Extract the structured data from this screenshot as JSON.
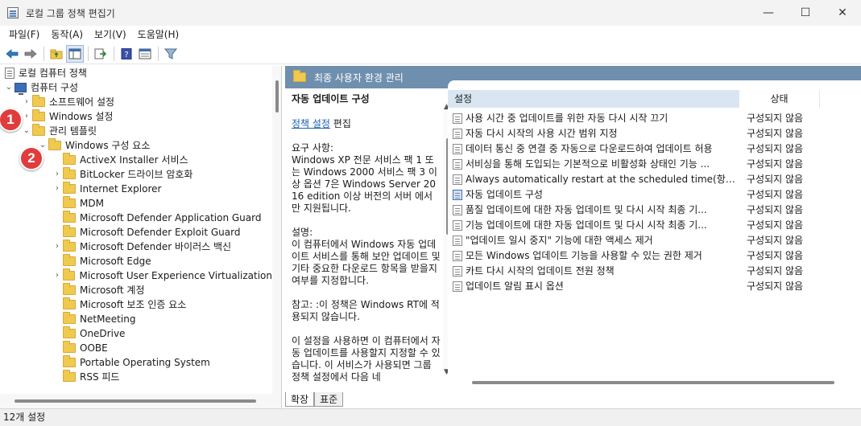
{
  "window": {
    "title": "로컬 그룹 정책 편집기",
    "controls": {
      "minimize": "—",
      "maximize": "☐",
      "close": "✕"
    }
  },
  "menu": [
    "파일(F)",
    "동작(A)",
    "보기(V)",
    "도움말(H)"
  ],
  "toolbar": [
    "back-icon",
    "forward-icon",
    "up-folder-icon",
    "show-hide-tree-icon",
    "export-list-icon",
    "help-icon",
    "properties-view-icon",
    "filter-icon"
  ],
  "tree": {
    "root": "로컬 컴퓨터 정책",
    "computer_config": "컴퓨터 구성",
    "software_settings": "소프트웨어 설정",
    "windows_settings": "Windows 설정",
    "admin_templates": "관리 템플릿",
    "windows_components": "Windows 구성 요소",
    "components": [
      {
        "label": "ActiveX Installer 서비스",
        "expandable": false
      },
      {
        "label": "BitLocker 드라이브 암호화",
        "expandable": true
      },
      {
        "label": "Internet Explorer",
        "expandable": true
      },
      {
        "label": "MDM",
        "expandable": false
      },
      {
        "label": "Microsoft Defender Application Guard",
        "expandable": false
      },
      {
        "label": "Microsoft Defender Exploit Guard",
        "expandable": false
      },
      {
        "label": "Microsoft Defender 바이러스 백신",
        "expandable": true
      },
      {
        "label": "Microsoft Edge",
        "expandable": false
      },
      {
        "label": "Microsoft User Experience Virtualization",
        "expandable": true
      },
      {
        "label": "Microsoft 계정",
        "expandable": false
      },
      {
        "label": "Microsoft 보조 인증 요소",
        "expandable": false
      },
      {
        "label": "NetMeeting",
        "expandable": false
      },
      {
        "label": "OneDrive",
        "expandable": false
      },
      {
        "label": "OOBE",
        "expandable": false
      },
      {
        "label": "Portable Operating System",
        "expandable": false
      },
      {
        "label": "RSS 피드",
        "expandable": false
      }
    ]
  },
  "badges": {
    "one": "1",
    "two": "2"
  },
  "right": {
    "header": "최종 사용자 환경 관리",
    "desc": {
      "title": "자동 업데이트 구성",
      "edit_link": "정책 설정",
      "edit_suffix": " 편집",
      "requirements": "요구 사항:\nWindows XP 전문 서비스 팩 1 또는 Windows 2000 서비스 팩 3 이상 옵션 7은 Windows Server 2016 edition 이상 버전의 서버 에서만 지원됩니다.",
      "description": "설명:\n이 컴퓨터에서 Windows 자동 업데이트 서비스를 통해 보안 업데이트 및 기타 중요한 다운로드 항목을 받을지 여부를 지정합니다.",
      "note": "참고: :이 정책은 Windows RT에 적용되지 않습니다.",
      "usage": "이 설정을 사용하면 이 컴퓨터에서 자동 업데이트를 사용할지 지정할 수 있습니다. 이 서비스가 사용되면 그룹 정책 설정에서 다음 네"
    },
    "columns": {
      "setting": "설정",
      "state": "상태"
    },
    "policies": [
      {
        "name": "사용 시간 중 업데이트를 위한 자동 다시 시작 끄기",
        "state": "구성되지 않음"
      },
      {
        "name": "자동 다시 시작의 사용 시간 범위 지정",
        "state": "구성되지 않음"
      },
      {
        "name": "데이터 통신 중 연결 중 자동으로 다운로드하여 업데이트 허용",
        "state": "구성되지 않음"
      },
      {
        "name": "서비싱을 통해 도입되는 기본적으로 비활성화 상태인 기능 ...",
        "state": "구성되지 않음"
      },
      {
        "name": "Always automatically restart at the scheduled time(항상 예...",
        "state": "구성되지 않음"
      },
      {
        "name": "자동 업데이트 구성",
        "state": "구성되지 않음"
      },
      {
        "name": "품질 업데이트에 대한 자동 업데이트 및 다시 시작 최종 기...",
        "state": "구성되지 않음"
      },
      {
        "name": "기능 업데이트에 대한 자동 업데이트 및 다시 시작 최종 기...",
        "state": "구성되지 않음"
      },
      {
        "name": "\"업데이트 일시 중지\" 기능에 대한 액세스 제거",
        "state": "구성되지 않음"
      },
      {
        "name": "모든 Windows 업데이트 기능을 사용할 수 있는 권한 제거",
        "state": "구성되지 않음"
      },
      {
        "name": "카트 다시 시작의 업데이트 전원 정책",
        "state": "구성되지 않음"
      },
      {
        "name": "업데이트 알림 표시 옵션",
        "state": "구성되지 않음"
      }
    ]
  },
  "tabs": [
    "확장",
    "표준"
  ],
  "status": "12개 설정"
}
